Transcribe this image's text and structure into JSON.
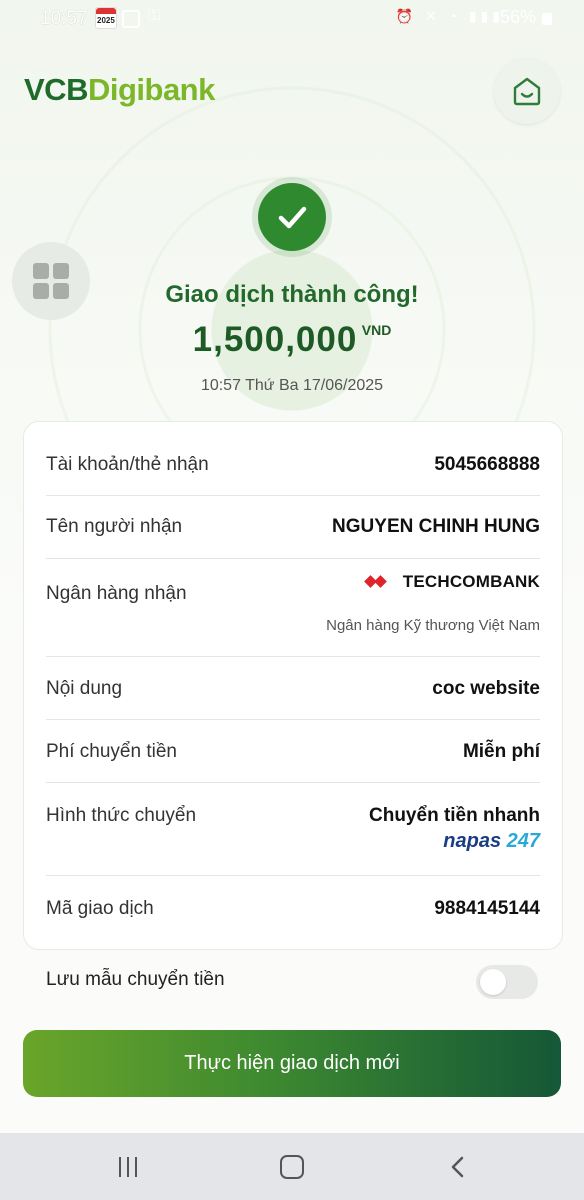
{
  "status_bar": {
    "time": "10:57",
    "calendar_badge": "2025",
    "battery": "56%"
  },
  "header": {
    "logo_vcb": "VCB",
    "logo_digibank": "Digibank"
  },
  "result": {
    "title": "Giao dịch thành công!",
    "amount": "1,500,000",
    "currency": "VND",
    "datetime": "10:57 Thứ Ba 17/06/2025"
  },
  "details": {
    "account_label": "Tài khoản/thẻ nhận",
    "account_value": "5045668888",
    "recipient_label": "Tên người nhận",
    "recipient_value": "NGUYEN CHINH HUNG",
    "bank_label": "Ngân hàng nhận",
    "bank_short": "TECHCOMBANK",
    "bank_full": "Ngân hàng Kỹ thương Việt Nam",
    "content_label": "Nội dung",
    "content_value": "coc website",
    "fee_label": "Phí chuyển tiền",
    "fee_value": "Miễn phí",
    "method_label": "Hình thức chuyển",
    "method_value": "Chuyển tiền nhanh",
    "napas_part1": "napas ",
    "napas_part2": "247",
    "txn_label": "Mã giao dịch",
    "txn_value": "9884145144"
  },
  "save_template": {
    "label": "Lưu mẫu chuyển tiền",
    "enabled": false
  },
  "actions": {
    "new_transaction": "Thực hiện giao dịch mới"
  },
  "colors": {
    "brand_dark": "#1f6b2c",
    "brand_light": "#7cb62a",
    "success": "#2f8a2f"
  }
}
